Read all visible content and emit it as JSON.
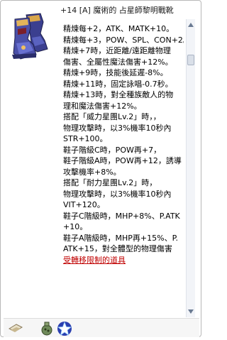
{
  "item": {
    "title": "+14 [A] 魔術的 占星師黎明戰靴",
    "image_icon": "boots-icon"
  },
  "description": [
    "精煉每+2，ATK、MATK+10。",
    "精煉每+3，POW、SPL、CON+2。",
    "精煉+7時，近距離/遠距離物理",
    "傷害、全屬性魔法傷害+12%。",
    "精煉+9時，技能後延遲-8%。",
    "精煉+11時，固定詠唱-0.7秒。",
    "精煉+13時，對全種族敵人的物",
    "理和魔法傷害+12%。",
    "搭配「威力星團Lv.2」時，，",
    "物理攻擊時，以3%機率10秒內",
    "STR+100。",
    "鞋子階級C時，POW再+7，",
    "鞋子階級A時，POW再+12，誘導",
    "攻擊機率+8%。",
    "搭配「耐力星團Lv.2」時，",
    "物理攻擊時，以3%機率10秒內",
    "VIT+120。",
    "鞋子C階級時，MHP+8%、P.ATK",
    "+10。",
    "鞋子A階級時，MHP再+15%、P.",
    "ATK+15，對全體型的物理傷害",
    "受轉移限制的道具"
  ],
  "desc_styles": {
    "21": "red underline"
  },
  "scrollbar": {
    "up_icon": "arrow-up-icon",
    "down_icon": "arrow-down-icon",
    "position": 0.05
  },
  "bottom_bar": {
    "icons": [
      "card-slot-icon",
      "bag-icon",
      "star-icon"
    ]
  },
  "colors": {
    "text": "#000000",
    "restriction": "#c00000",
    "scroll_bg": "#f2f4f8"
  }
}
